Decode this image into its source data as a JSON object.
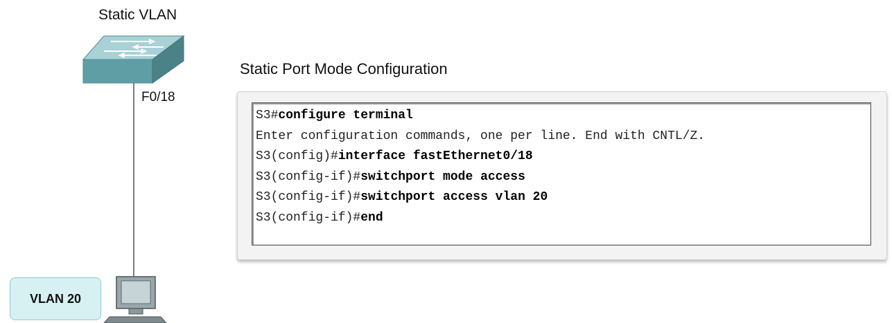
{
  "diagram": {
    "title": "Static VLAN",
    "port_label": "F0/18",
    "vlan_badge": "VLAN 20"
  },
  "config": {
    "title": "Static Port Mode Configuration",
    "lines": [
      {
        "prompt": "S3#",
        "command": "configure terminal"
      },
      {
        "prompt": "Enter configuration commands, one per line. End with CNTL/Z.",
        "command": ""
      },
      {
        "prompt": "S3(config)#",
        "command": "interface fastEthernet0/18"
      },
      {
        "prompt": "S3(config-if)#",
        "command": "switchport mode access"
      },
      {
        "prompt": "S3(config-if)#",
        "command": "switchport access vlan 20"
      },
      {
        "prompt": "S3(config-if)#",
        "command": "end"
      }
    ]
  },
  "colors": {
    "switch_teal": "#5fa7ad",
    "badge_fill": "#d7f1f3",
    "monitor_gray": "#9aa7ab"
  },
  "icons": [
    "switch-icon",
    "pc-icon"
  ]
}
